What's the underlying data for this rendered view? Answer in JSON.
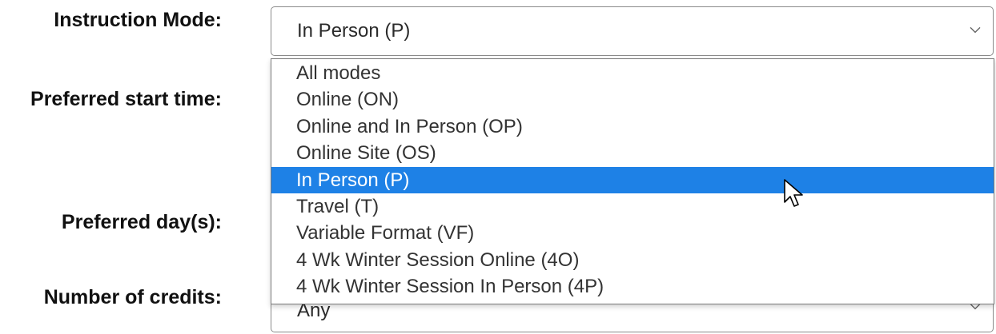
{
  "form": {
    "instruction_mode_label": "Instruction Mode:",
    "preferred_start_time_label": "Preferred start time:",
    "preferred_days_label": "Preferred day(s):",
    "number_of_credits_label": "Number of credits:",
    "instruction_mode_value": "In Person (P)",
    "number_of_credits_value": "Any"
  },
  "dropdown": {
    "options": [
      "All modes",
      "Online (ON)",
      "Online and In Person (OP)",
      "Online Site (OS)",
      "In Person (P)",
      "Travel (T)",
      "Variable Format (VF)",
      "4 Wk Winter Session Online (4O)",
      "4 Wk Winter Session In Person (4P)"
    ],
    "selected_index": 4
  },
  "colors": {
    "selected_bg": "#1e81e6",
    "selected_text": "#ffffff"
  },
  "icons": {
    "select_arrow": "chevron-down-icon",
    "cursor": "mouse-pointer-icon"
  }
}
